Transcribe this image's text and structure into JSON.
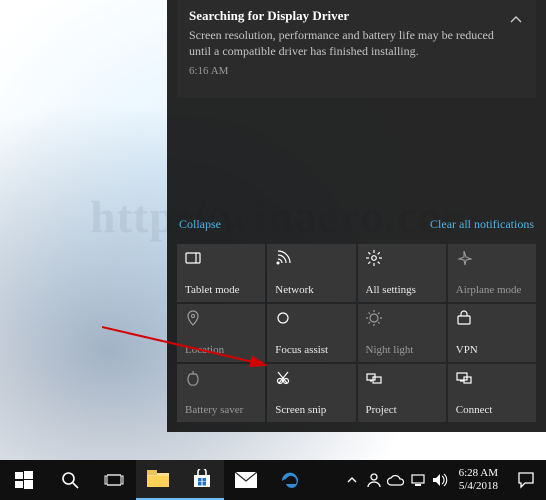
{
  "watermark": "http://winaero.com",
  "notification": {
    "title": "Searching for Display Driver",
    "body": "Screen resolution, performance and battery life may be reduced until a compatible driver has finished installing.",
    "time": "6:16 AM"
  },
  "links": {
    "collapse": "Collapse",
    "clear": "Clear all notifications"
  },
  "tiles": [
    {
      "label": "Tablet mode",
      "icon": "tablet-mode-icon",
      "dim": false
    },
    {
      "label": "Network",
      "icon": "network-icon",
      "dim": false
    },
    {
      "label": "All settings",
      "icon": "settings-gear-icon",
      "dim": false
    },
    {
      "label": "Airplane mode",
      "icon": "airplane-icon",
      "dim": true
    },
    {
      "label": "Location",
      "icon": "location-pin-icon",
      "dim": true
    },
    {
      "label": "Focus assist",
      "icon": "focus-assist-icon",
      "dim": false
    },
    {
      "label": "Night light",
      "icon": "night-light-icon",
      "dim": true
    },
    {
      "label": "VPN",
      "icon": "vpn-icon",
      "dim": false
    },
    {
      "label": "Battery saver",
      "icon": "battery-saver-icon",
      "dim": true
    },
    {
      "label": "Screen snip",
      "icon": "screen-snip-icon",
      "dim": false
    },
    {
      "label": "Project",
      "icon": "project-icon",
      "dim": false
    },
    {
      "label": "Connect",
      "icon": "connect-icon",
      "dim": false
    }
  ],
  "clock": {
    "time": "6:28 AM",
    "date": "5/4/2018"
  }
}
